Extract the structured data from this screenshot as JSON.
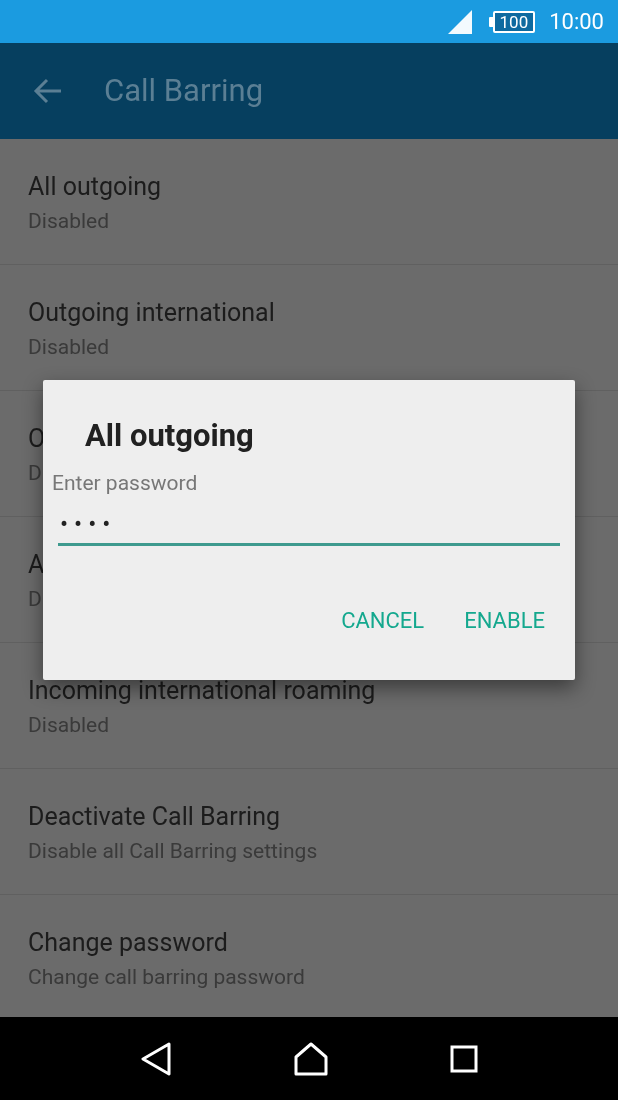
{
  "status_bar": {
    "battery": "100",
    "time": "10:00"
  },
  "app_bar": {
    "title": "Call Barring"
  },
  "items": [
    {
      "title": "All outgoing",
      "subtitle": "Disabled"
    },
    {
      "title": "Outgoing international",
      "subtitle": "Disabled"
    },
    {
      "title": "O",
      "subtitle": "D"
    },
    {
      "title": "A",
      "subtitle": "D"
    },
    {
      "title": "Incoming international roaming",
      "subtitle": "Disabled"
    },
    {
      "title": "Deactivate Call Barring",
      "subtitle": "Disable all Call Barring settings"
    },
    {
      "title": "Change password",
      "subtitle": "Change call barring password"
    }
  ],
  "dialog": {
    "title": "All outgoing",
    "label": "Enter password",
    "value": "••••",
    "buttons": [
      "CANCEL",
      "ENABLE"
    ]
  }
}
